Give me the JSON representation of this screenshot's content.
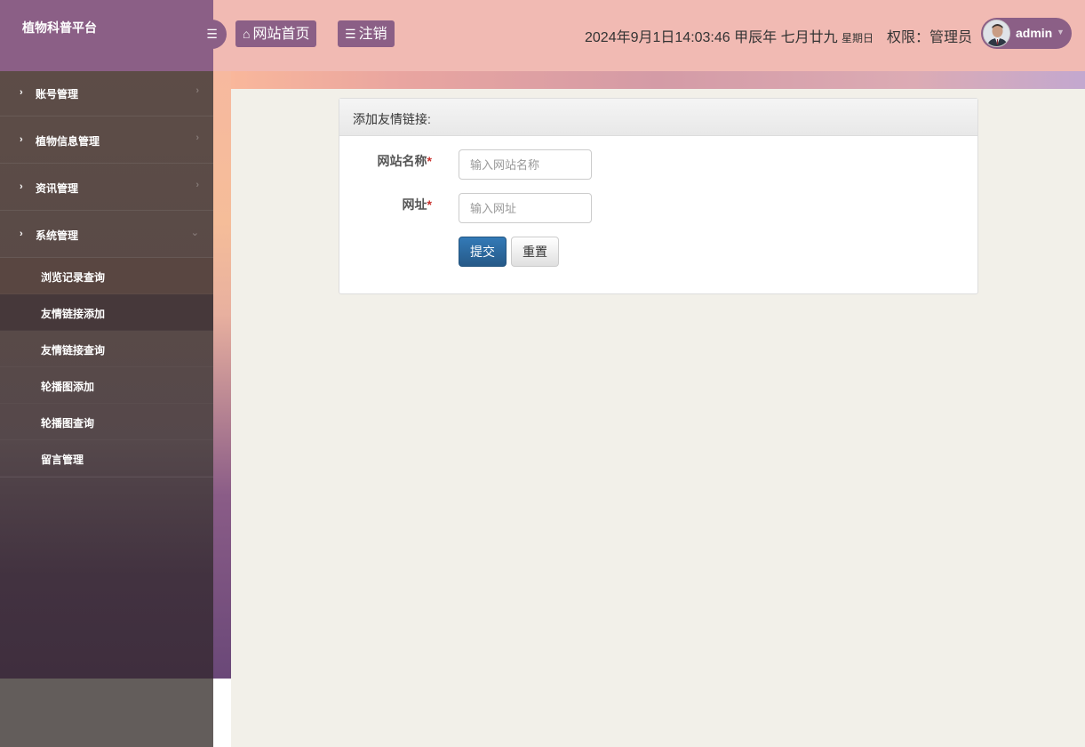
{
  "app": {
    "title": "植物科普平台"
  },
  "header": {
    "toggle_icon": "bars-icon",
    "home_label": "网站首页",
    "logout_label": "注销",
    "datetime": "2024年9月1日14:03:46 甲辰年 七月廿九",
    "weekday": "星期日",
    "role": "权限：管理员",
    "username": "admin"
  },
  "sidebar": {
    "items": [
      {
        "label": "账号管理"
      },
      {
        "label": "植物信息管理"
      },
      {
        "label": "资讯管理"
      },
      {
        "label": "系统管理"
      }
    ],
    "submenu": [
      {
        "label": "浏览记录查询"
      },
      {
        "label": "友情链接添加"
      },
      {
        "label": "友情链接查询"
      },
      {
        "label": "轮播图添加"
      },
      {
        "label": "轮播图查询"
      },
      {
        "label": "留言管理"
      }
    ],
    "active_submenu": "友情链接添加"
  },
  "form": {
    "title": "添加友情链接:",
    "fields": [
      {
        "label": "网站名称",
        "placeholder": "输入网站名称",
        "value": ""
      },
      {
        "label": "网址",
        "placeholder": "输入网址",
        "value": ""
      }
    ],
    "required_mark": "*",
    "submit_label": "提交",
    "reset_label": "重置"
  },
  "colors": {
    "accent": "#8b5f86",
    "header_bg": "#f1bab3",
    "primary_button": "#337ab7",
    "required": "#c9302c"
  }
}
